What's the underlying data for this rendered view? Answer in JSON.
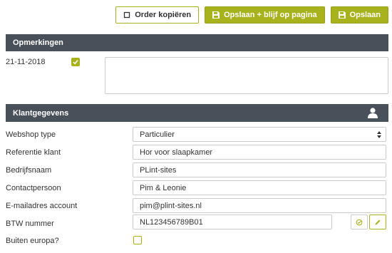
{
  "toolbar": {
    "copy_label": "Order kopiëren",
    "save_stay_label": "Opslaan + blijf op pagina",
    "save_label": "Opslaan"
  },
  "remarks": {
    "title": "Opmerkingen",
    "date": "21-11-2018",
    "checked": true,
    "text": ""
  },
  "customer": {
    "title": "Klantgegevens",
    "fields": [
      {
        "label": "Webshop type",
        "value": "Particulier"
      },
      {
        "label": "Referentie klant",
        "value": "Hor voor slaapkamer"
      },
      {
        "label": "Bedrijfsnaam",
        "value": "PLint-sites"
      },
      {
        "label": "Contactpersoon",
        "value": "Pim & Leonie"
      },
      {
        "label": "E-mailadres account",
        "value": "pim@plint-sites.nl"
      },
      {
        "label": "BTW nummer",
        "value": "NL123456789B01"
      },
      {
        "label": "Buiten europa?",
        "value": ""
      }
    ]
  },
  "colors": {
    "accent": "#a7b21c",
    "header_bg": "#48505a"
  }
}
